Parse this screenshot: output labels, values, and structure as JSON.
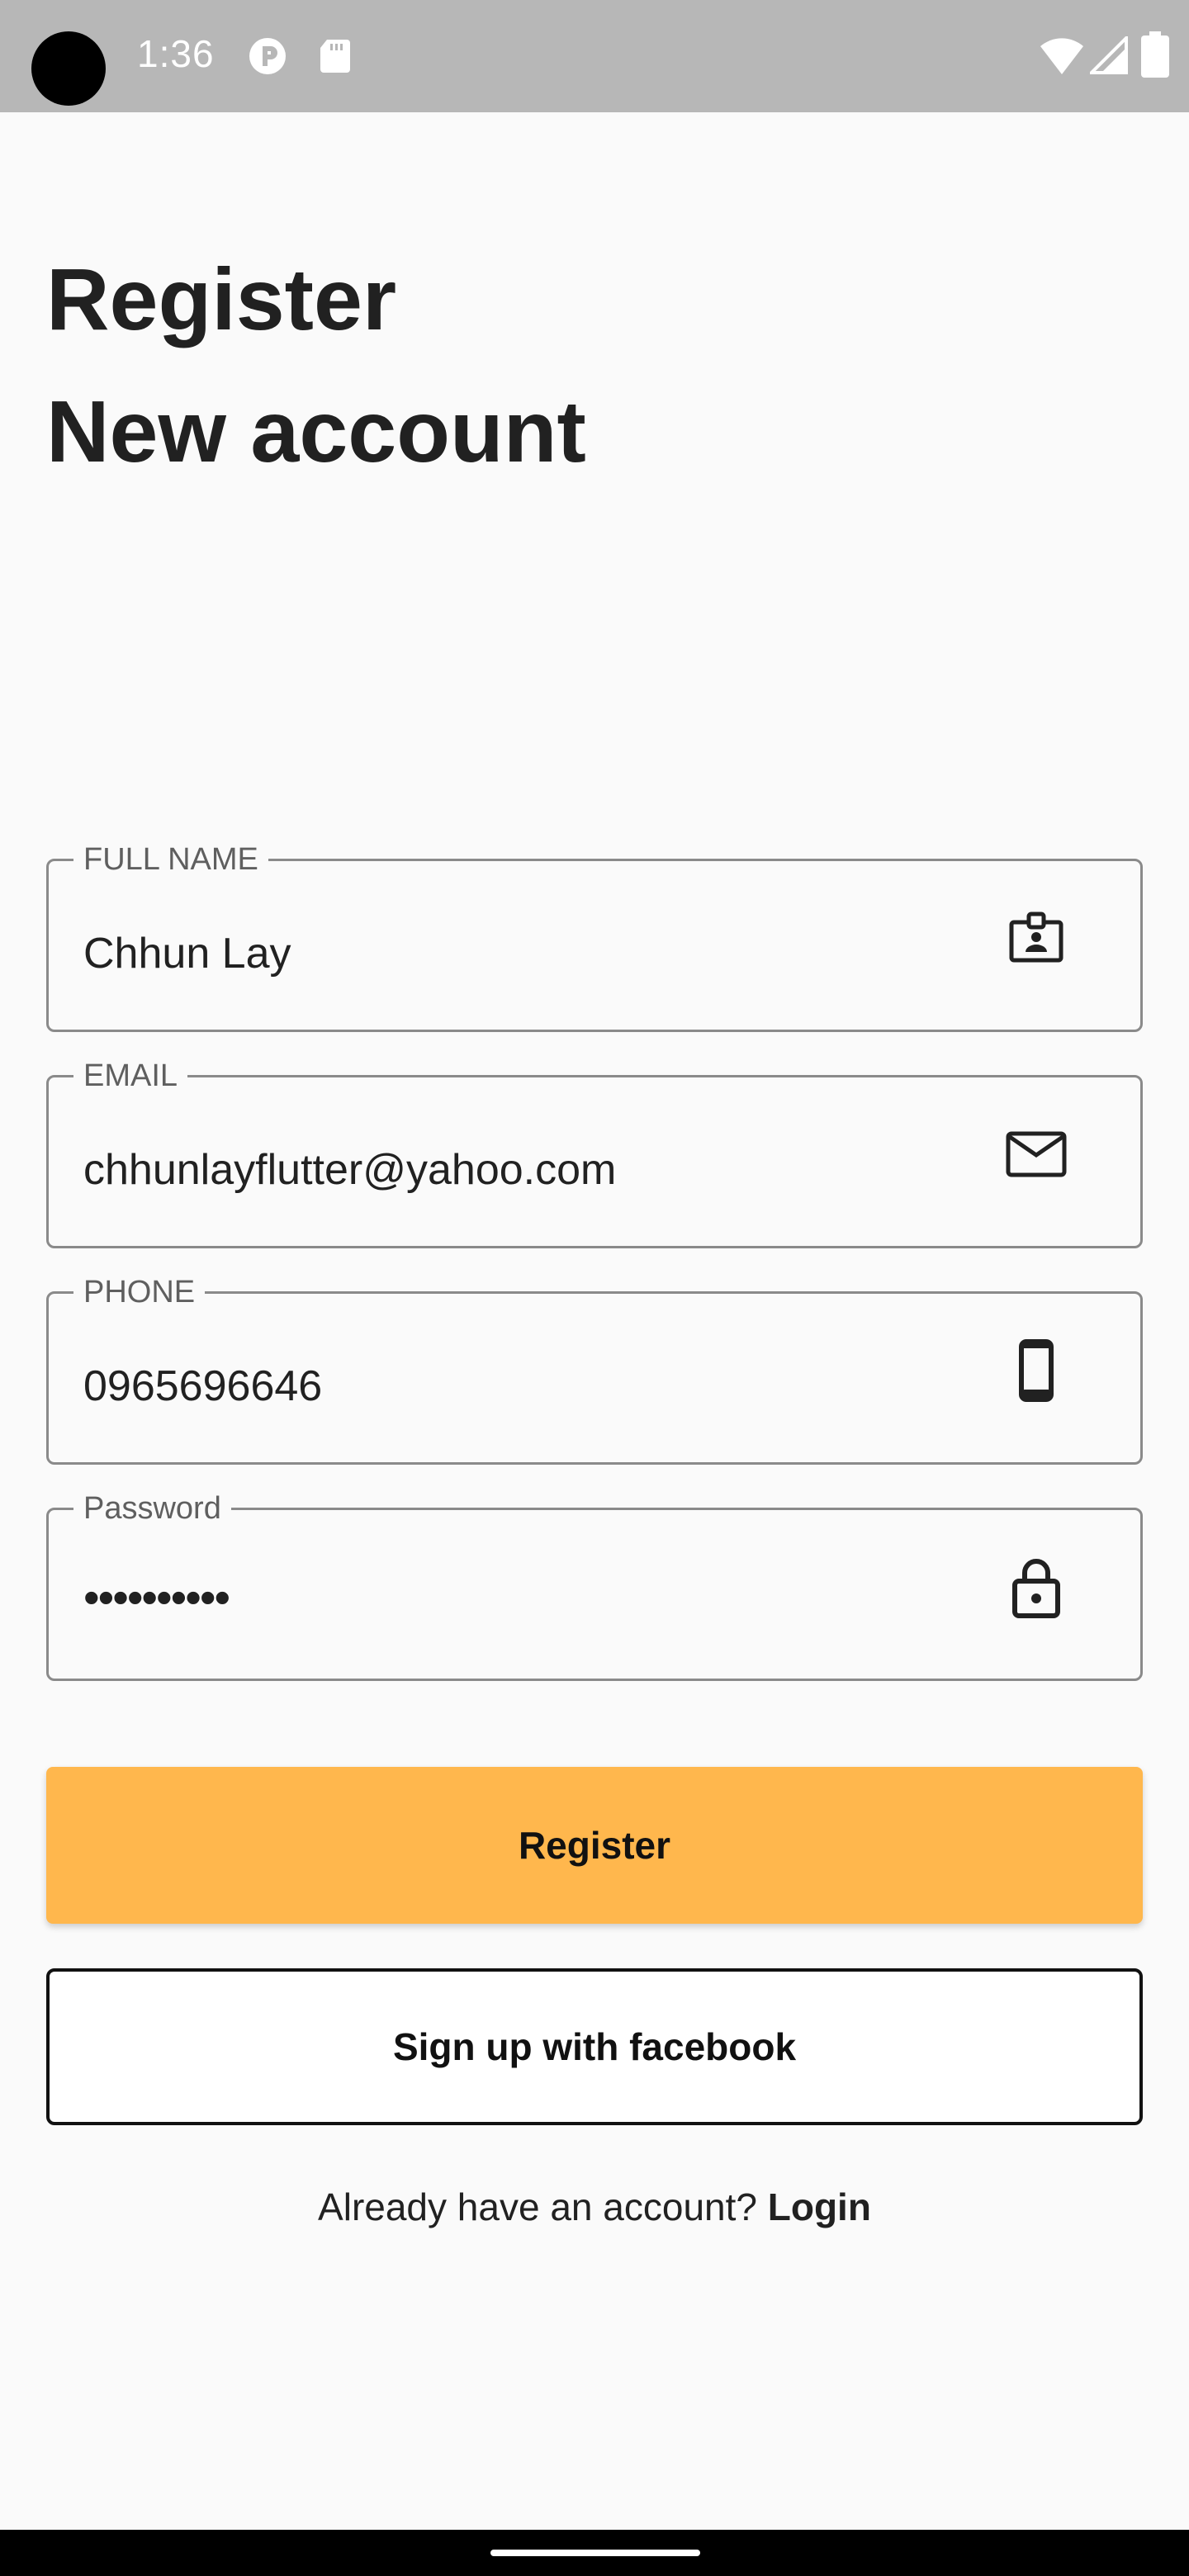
{
  "status_bar": {
    "time": "1:36",
    "icons": [
      "notification-p-icon",
      "sd-card-icon",
      "wifi-icon",
      "signal-icon",
      "battery-icon"
    ]
  },
  "header": {
    "title_line1": "Register",
    "title_line2": "New account"
  },
  "form": {
    "full_name": {
      "label": "FULL NAME",
      "value": "Chhun Lay",
      "icon": "contact-card-icon"
    },
    "email": {
      "label": "EMAIL",
      "value": "chhunlayflutter@yahoo.com",
      "icon": "mail-icon"
    },
    "phone": {
      "label": "PHONE",
      "value": "0965696646",
      "icon": "phone-icon"
    },
    "password": {
      "label": "Password",
      "value": "••••••••••",
      "icon": "lock-icon"
    }
  },
  "buttons": {
    "register": "Register",
    "facebook": "Sign up with facebook"
  },
  "footer": {
    "prompt": "Already have an account?",
    "login": "Login"
  },
  "colors": {
    "accent": "#ffb74d",
    "status_bar": "#b7b7b7",
    "background": "#fafafa"
  }
}
